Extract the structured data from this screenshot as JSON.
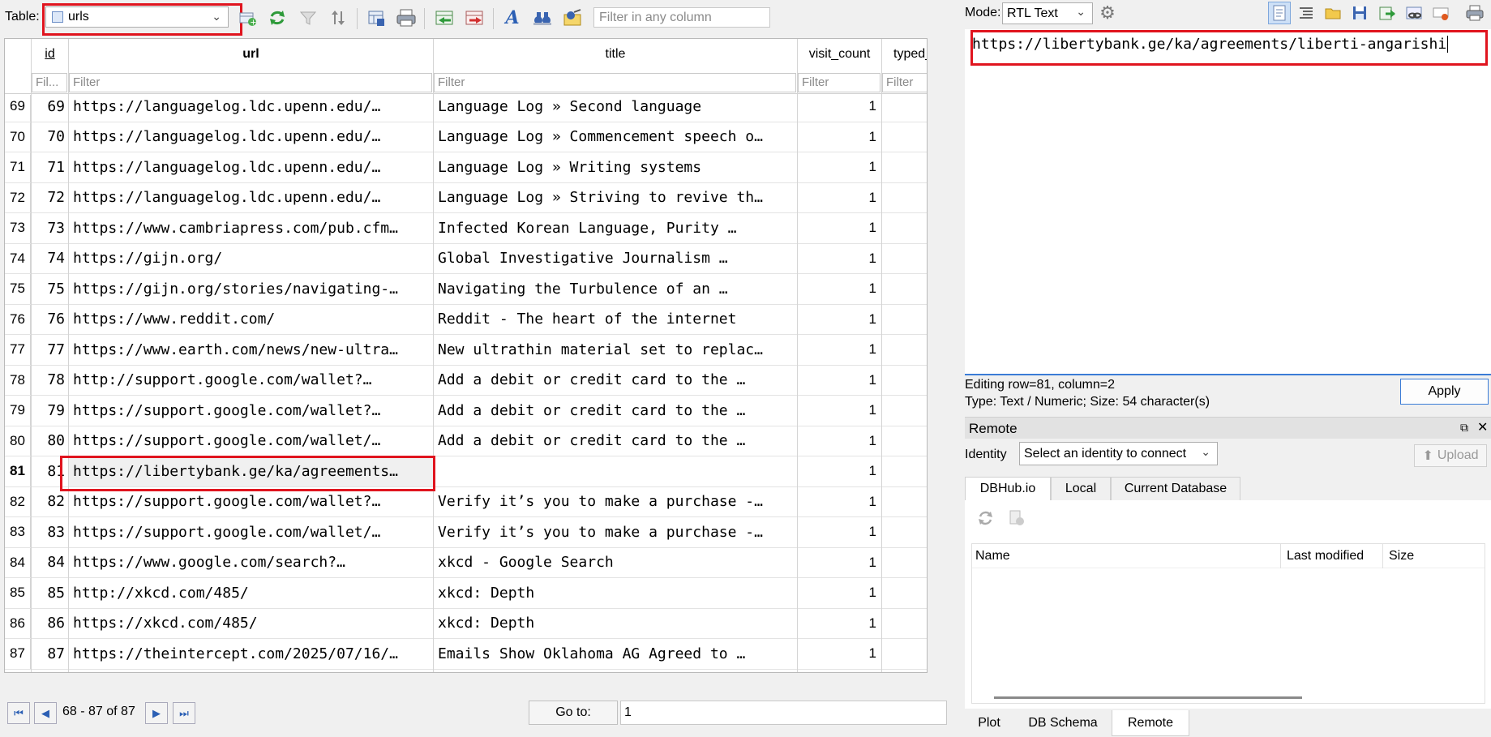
{
  "toolbar": {
    "table_label": "Table:",
    "table_value": "urls",
    "filter_placeholder": "Filter in any column"
  },
  "grid": {
    "columns": [
      "id",
      "url",
      "title",
      "visit_count",
      "typed_"
    ],
    "filters": [
      "Fil...",
      "Filter",
      "Filter",
      "Filter",
      "Filter"
    ],
    "rows": [
      {
        "rn": "69",
        "id": "69",
        "url": "https://languagelog.ldc.upenn.edu/…",
        "title": "Language Log » Second language",
        "visit_count": "1"
      },
      {
        "rn": "70",
        "id": "70",
        "url": "https://languagelog.ldc.upenn.edu/…",
        "title": "Language Log » Commencement speech o…",
        "visit_count": "1"
      },
      {
        "rn": "71",
        "id": "71",
        "url": "https://languagelog.ldc.upenn.edu/…",
        "title": "Language Log » Writing systems",
        "visit_count": "1"
      },
      {
        "rn": "72",
        "id": "72",
        "url": "https://languagelog.ldc.upenn.edu/…",
        "title": "Language Log » Striving to revive th…",
        "visit_count": "1"
      },
      {
        "rn": "73",
        "id": "73",
        "url": "https://www.cambriapress.com/pub.cfm…",
        "title": "Infected Korean Language, Purity …",
        "visit_count": "1"
      },
      {
        "rn": "74",
        "id": "74",
        "url": "https://gijn.org/",
        "title": "Global Investigative Journalism …",
        "visit_count": "1"
      },
      {
        "rn": "75",
        "id": "75",
        "url": "https://gijn.org/stories/navigating-…",
        "title": "Navigating the Turbulence of an …",
        "visit_count": "1"
      },
      {
        "rn": "76",
        "id": "76",
        "url": "https://www.reddit.com/",
        "title": "Reddit - The heart of the internet",
        "visit_count": "1"
      },
      {
        "rn": "77",
        "id": "77",
        "url": "https://www.earth.com/news/new-ultra…",
        "title": "New ultrathin material set to replac…",
        "visit_count": "1"
      },
      {
        "rn": "78",
        "id": "78",
        "url": "http://support.google.com/wallet?…",
        "title": "Add a debit or credit card to the …",
        "visit_count": "1"
      },
      {
        "rn": "79",
        "id": "79",
        "url": "https://support.google.com/wallet?…",
        "title": "Add a debit or credit card to the …",
        "visit_count": "1"
      },
      {
        "rn": "80",
        "id": "80",
        "url": "https://support.google.com/wallet/…",
        "title": "Add a debit or credit card to the …",
        "visit_count": "1"
      },
      {
        "rn": "81",
        "id": "81",
        "url": "https://libertybank.ge/ka/agreements…",
        "title": "",
        "visit_count": "1"
      },
      {
        "rn": "82",
        "id": "82",
        "url": "https://support.google.com/wallet?…",
        "title": "Verify it’s you to make a purchase -…",
        "visit_count": "1"
      },
      {
        "rn": "83",
        "id": "83",
        "url": "https://support.google.com/wallet/…",
        "title": "Verify it’s you to make a purchase -…",
        "visit_count": "1"
      },
      {
        "rn": "84",
        "id": "84",
        "url": "https://www.google.com/search?…",
        "title": "xkcd - Google Search",
        "visit_count": "1"
      },
      {
        "rn": "85",
        "id": "85",
        "url": "http://xkcd.com/485/",
        "title": "xkcd: Depth",
        "visit_count": "1"
      },
      {
        "rn": "86",
        "id": "86",
        "url": "https://xkcd.com/485/",
        "title": "xkcd: Depth",
        "visit_count": "1"
      },
      {
        "rn": "87",
        "id": "87",
        "url": "https://theintercept.com/2025/07/16/…",
        "title": "Emails Show Oklahoma AG Agreed to …",
        "visit_count": "1"
      }
    ]
  },
  "nav": {
    "range_text": "68 - 87 of 87",
    "goto_label": "Go to:",
    "goto_value": "1"
  },
  "editor": {
    "mode_label": "Mode:",
    "mode_value": "RTL Text",
    "content": "https://libertybank.ge/ka/agreements/liberti-angarishi",
    "status_line1": "Editing row=81, column=2",
    "status_line2": "Type: Text / Numeric; Size: 54 character(s)",
    "apply_label": "Apply"
  },
  "remote": {
    "title": "Remote",
    "identity_label": "Identity",
    "identity_value": "Select an identity to connect",
    "upload_label": "Upload",
    "tabs": [
      "DBHub.io",
      "Local",
      "Current Database"
    ],
    "columns": [
      "Name",
      "Last modified",
      "Size"
    ]
  },
  "bottom_tabs": [
    "Plot",
    "DB Schema",
    "Remote"
  ],
  "colors": {
    "highlight": "#e0141e",
    "accent": "#3b7cd6"
  }
}
